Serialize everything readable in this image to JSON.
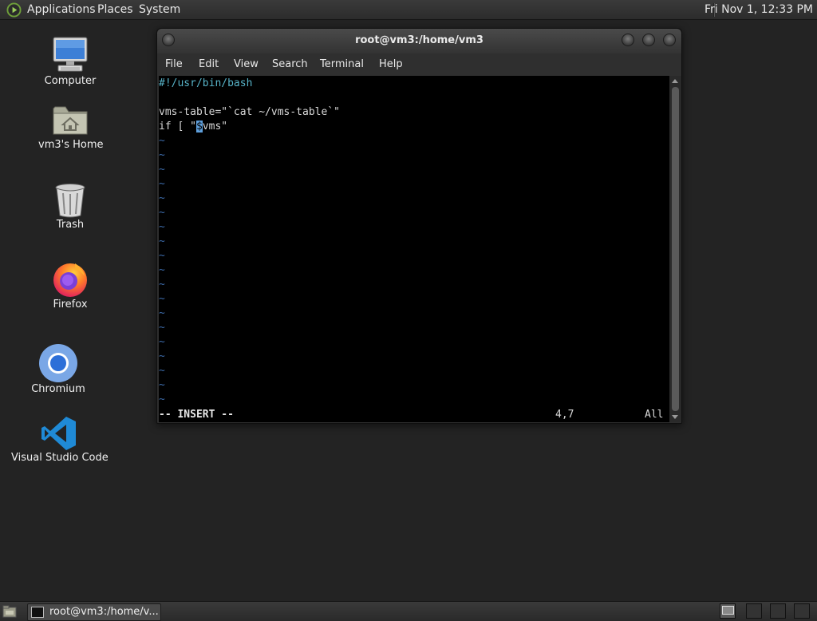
{
  "top_panel": {
    "applications": "Applications",
    "places": "Places",
    "system": "System",
    "clock": "Fri Nov  1, 12:33 PM"
  },
  "desktop": {
    "icons": [
      {
        "label": "Computer",
        "icon": "computer-icon"
      },
      {
        "label": "vm3's Home",
        "icon": "home-folder-icon"
      },
      {
        "label": "Trash",
        "icon": "trash-icon"
      },
      {
        "label": "Firefox",
        "icon": "firefox-icon"
      },
      {
        "label": "Chromium",
        "icon": "chromium-icon"
      },
      {
        "label": "Visual Studio Code",
        "icon": "vscode-icon"
      }
    ]
  },
  "terminal": {
    "title": "root@vm3:/home/vm3",
    "menu": [
      "File",
      "Edit",
      "View",
      "Search",
      "Terminal",
      "Help"
    ],
    "lines": {
      "line1": "#!/usr/bin/bash",
      "line2": "",
      "line3": "vms-table=\"`cat ~/vms-table`\"",
      "line4_before": "if [ \"",
      "line4_cursor": "$",
      "line4_after": "vms\""
    },
    "tilde": "~",
    "status": {
      "mode": "-- INSERT --",
      "position": "4,7",
      "scroll": "All"
    }
  },
  "taskbar": {
    "window_label": "root@vm3:/home/v...",
    "workspaces": 4,
    "active_workspace": 1
  },
  "colors": {
    "desktop_bg": "#232323",
    "terminal_bg": "#000000",
    "tilde": "#3c6aa8",
    "shebang": "#57b3c8",
    "cursor": "#5fa0dd"
  }
}
